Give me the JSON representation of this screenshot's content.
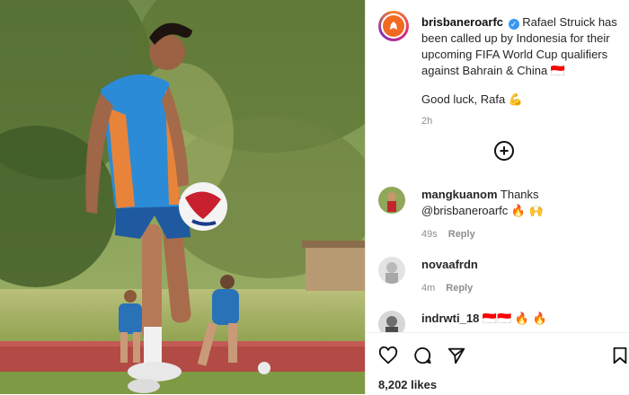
{
  "post": {
    "username": "brisbaneroarfc",
    "caption": "Rafael Struick has been called up by Indonesia for their upcoming FIFA World Cup qualifiers against Bahrain & China 🇮🇩",
    "caption_extra": "Good luck, Rafa 💪",
    "time": "2h"
  },
  "comments": [
    {
      "username": "mangkuanom",
      "text": "Thanks @brisbaneroarfc 🔥 🙌",
      "time": "49s",
      "reply_label": "Reply"
    },
    {
      "username": "novaafrdn",
      "text": "",
      "time": "4m",
      "reply_label": "Reply"
    },
    {
      "username": "indrwti_18",
      "text": "🇮🇩🇮🇩 🔥 🔥",
      "time": "",
      "reply_label": ""
    }
  ],
  "likes": "8,202 likes",
  "icons": {
    "like": "heart-icon",
    "comment": "comment-icon",
    "share": "send-icon",
    "save": "bookmark-icon",
    "more": "plus-circle-icon"
  },
  "colors": {
    "verified": "#3897f0",
    "brand": "#f26a21"
  }
}
